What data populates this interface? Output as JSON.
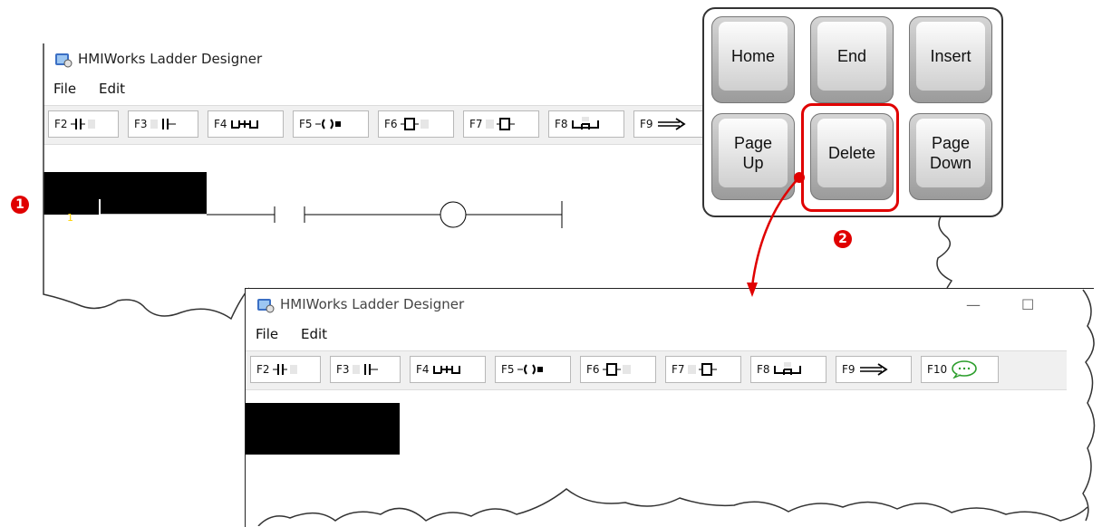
{
  "window1": {
    "title": "HMIWorks Ladder Designer",
    "menu": [
      "File",
      "Edit"
    ],
    "toolbar": [
      "F2",
      "F3",
      "F4",
      "F5",
      "F6",
      "F7",
      "F8",
      "F9"
    ],
    "rung_number": "1"
  },
  "window2": {
    "title": "HMIWorks Ladder Designer",
    "menu": [
      "File",
      "Edit"
    ],
    "toolbar": [
      "F2",
      "F3",
      "F4",
      "F5",
      "F6",
      "F7",
      "F8",
      "F9",
      "F10"
    ],
    "minimize_glyph": "—",
    "maximize_glyph": "☐"
  },
  "keypad": {
    "keys": [
      "Home",
      "End",
      "Insert",
      "Page\nUp",
      "Delete",
      "Page\nDown"
    ],
    "highlighted": "Delete",
    "highlight_color": "#e00000"
  },
  "steps": [
    "1",
    "2"
  ],
  "colors": {
    "accent": "#e00000",
    "coil_color": "#00a000",
    "black": "#000000"
  }
}
